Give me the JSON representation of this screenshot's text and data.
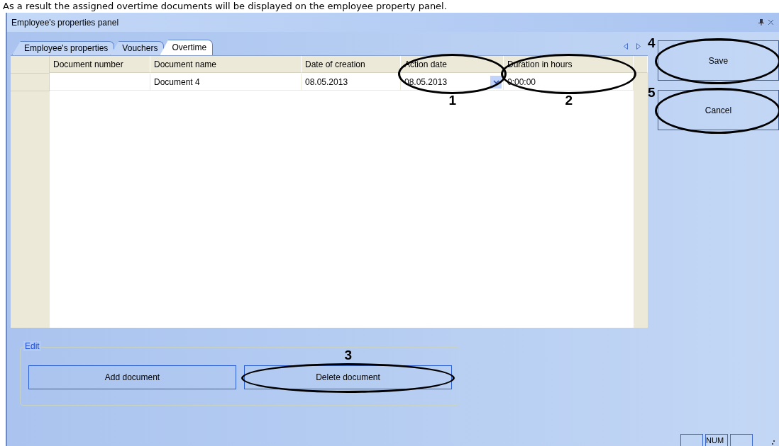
{
  "caption": "As a result the assigned overtime documents will be displayed on the employee property panel.",
  "window": {
    "title": "Employee's properties panel"
  },
  "tabs": [
    {
      "label": "Employee's properties",
      "selected": false
    },
    {
      "label": "Vouchers",
      "selected": false
    },
    {
      "label": "Overtime",
      "selected": true
    }
  ],
  "table": {
    "columns": [
      {
        "label": "Document number"
      },
      {
        "label": "Document name"
      },
      {
        "label": "Date of creation"
      },
      {
        "label": "Action date",
        "callout": "1"
      },
      {
        "label": "Duration in hours",
        "callout": "2"
      }
    ],
    "rows": [
      {
        "selected": false,
        "cells": [
          "",
          "Document 4",
          "08.05.2013",
          "08.05.2013",
          "0:00:00"
        ]
      }
    ]
  },
  "side_buttons": [
    {
      "label": "Save",
      "callout": "4"
    },
    {
      "label": "Cancel",
      "callout": "5"
    }
  ],
  "edit_group": {
    "title": "Edit",
    "buttons": [
      {
        "label": "Add document"
      },
      {
        "label": "Delete document",
        "callout": "3"
      }
    ]
  },
  "status_bar": {
    "num_lock": "NUM"
  }
}
